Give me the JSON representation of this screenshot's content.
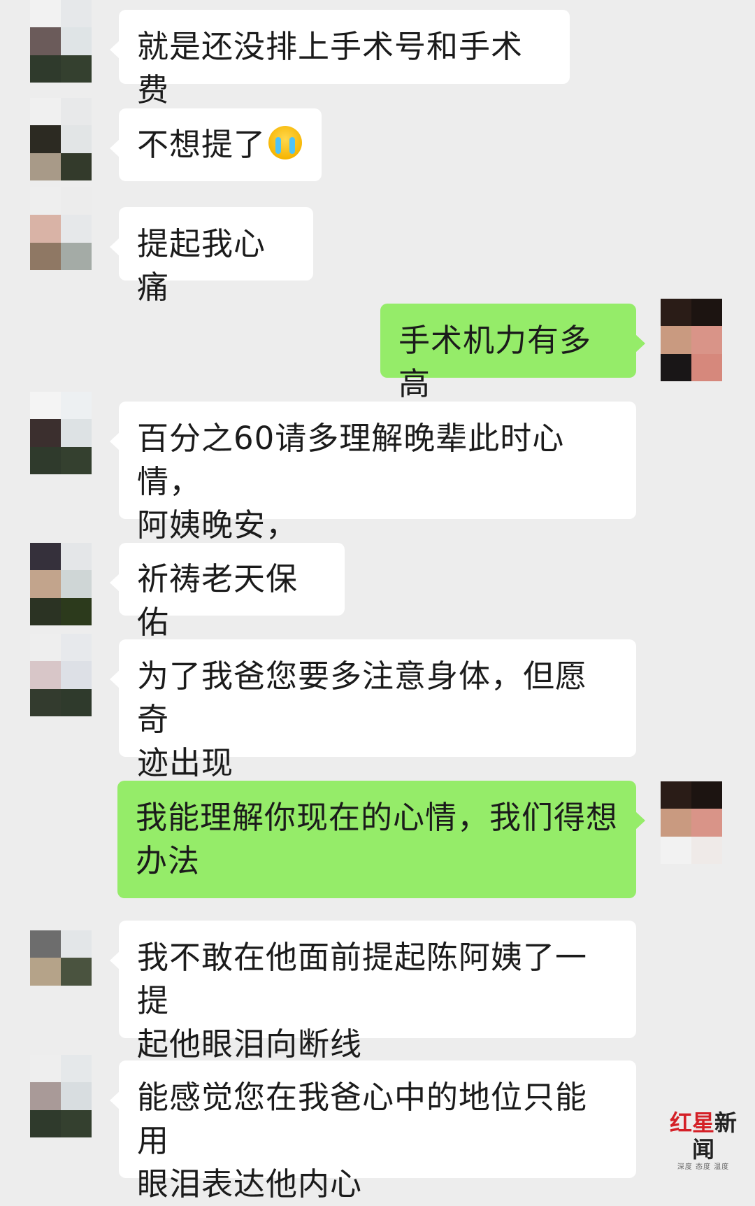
{
  "messages": [
    {
      "side": "in",
      "text": "就是还没排上手术号和手术费"
    },
    {
      "side": "in",
      "text": "不想提了",
      "emoji": "loudly-crying-face"
    },
    {
      "side": "in",
      "text": "提起我心痛"
    },
    {
      "side": "out",
      "text": "手术机力有多高"
    },
    {
      "side": "in",
      "text": "百分之60请多理解晚辈此时心情，\n阿姨晚安，"
    },
    {
      "side": "in",
      "text": "祈祷老天保佑"
    },
    {
      "side": "in",
      "text": "为了我爸您要多注意身体，但愿奇\n迹出现"
    },
    {
      "side": "out",
      "text": "我能理解你现在的心情，我们得想\n办法"
    },
    {
      "side": "in",
      "text": "我不敢在他面前提起陈阿姨了一提\n起他眼泪向断线"
    },
    {
      "side": "in",
      "text": "能感觉您在我爸心中的地位只能用\n眼泪表达他内心"
    }
  ],
  "watermark": {
    "title_red": "红星",
    "title_black": "新闻",
    "subtitle": "深度 态度 温度"
  },
  "colors": {
    "background": "#ededed",
    "incoming_bubble": "#ffffff",
    "outgoing_bubble": "#95ec69"
  }
}
